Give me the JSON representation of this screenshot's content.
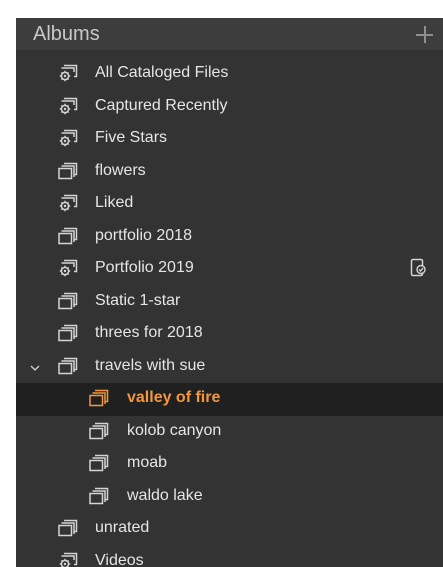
{
  "panel": {
    "title": "Albums",
    "add_icon": "plus-icon"
  },
  "albums": [
    {
      "label": "All Cataloged Files",
      "icon": "smart-album-icon",
      "level": 0
    },
    {
      "label": "Captured Recently",
      "icon": "smart-album-icon",
      "level": 0
    },
    {
      "label": "Five Stars",
      "icon": "smart-album-icon",
      "level": 0
    },
    {
      "label": "flowers",
      "icon": "album-icon",
      "level": 0
    },
    {
      "label": "Liked",
      "icon": "smart-album-icon",
      "level": 0
    },
    {
      "label": "portfolio 2018",
      "icon": "album-icon",
      "level": 0
    },
    {
      "label": "Portfolio 2019",
      "icon": "smart-album-icon",
      "level": 0,
      "badge": "mobile-sync-icon"
    },
    {
      "label": "Static 1-star",
      "icon": "album-icon",
      "level": 0
    },
    {
      "label": "threes for 2018",
      "icon": "album-icon",
      "level": 0
    },
    {
      "label": "travels with sue",
      "icon": "album-icon",
      "level": 0,
      "expanded": true
    },
    {
      "label": "valley of fire",
      "icon": "album-icon",
      "level": 1,
      "selected": true
    },
    {
      "label": "kolob canyon",
      "icon": "album-icon",
      "level": 1
    },
    {
      "label": "moab",
      "icon": "album-icon",
      "level": 1
    },
    {
      "label": "waldo lake",
      "icon": "album-icon",
      "level": 1
    },
    {
      "label": "unrated",
      "icon": "album-icon",
      "level": 0
    },
    {
      "label": "Videos",
      "icon": "smart-album-icon",
      "level": 0
    }
  ],
  "colors": {
    "panel_bg": "#333333",
    "header_bg": "#3d3d3d",
    "selected_bg": "#202020",
    "text": "#e6e6e6",
    "selected_text": "#f3963c",
    "icon": "#d4d4d4"
  }
}
